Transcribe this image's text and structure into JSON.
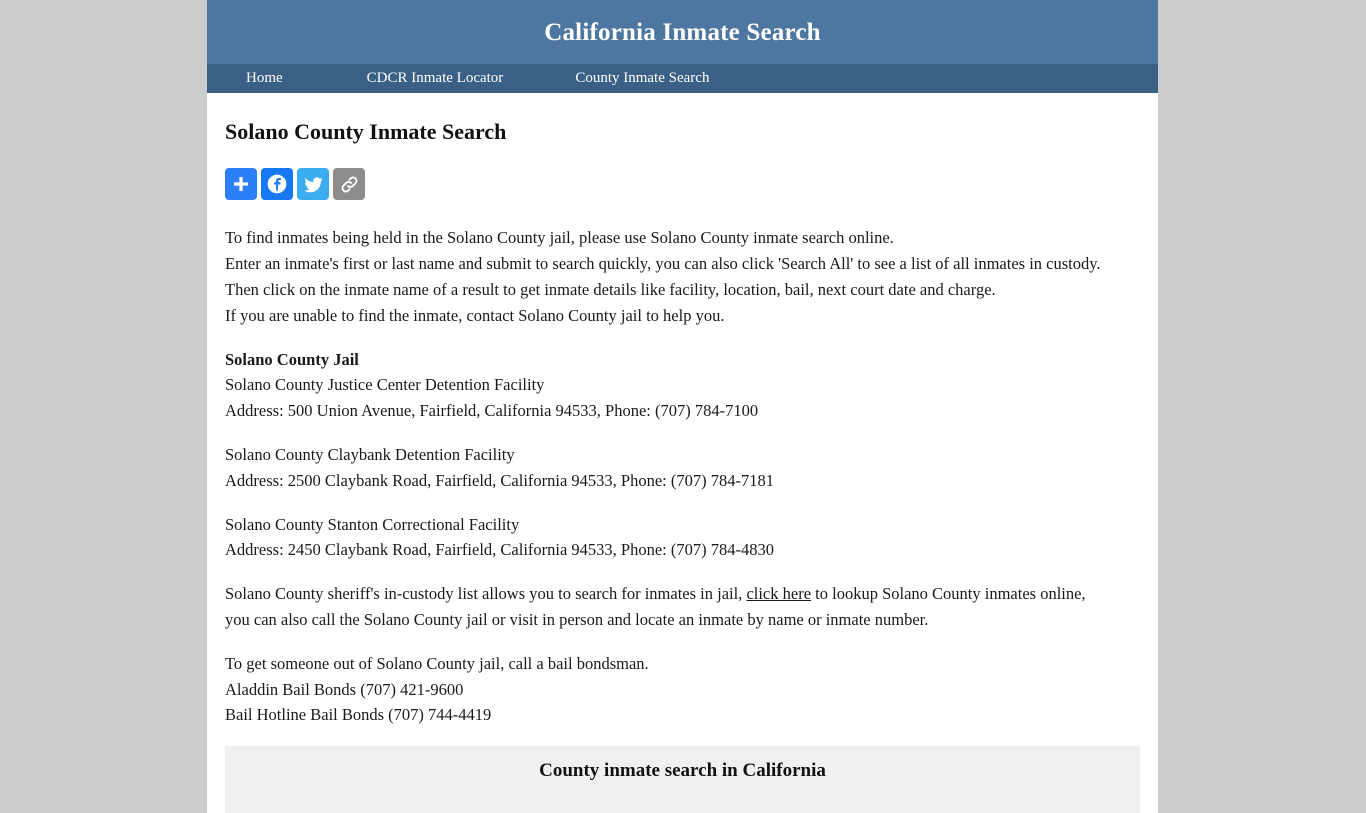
{
  "site": {
    "title": "California Inmate Search",
    "header_bg": "#4d76a0",
    "nav_bg": "#3a6086",
    "page_bg": "#cccccc"
  },
  "nav": {
    "items": [
      {
        "label": "Home"
      },
      {
        "label": "CDCR Inmate Locator"
      },
      {
        "label": "County Inmate Search"
      }
    ]
  },
  "page": {
    "heading": "Solano County Inmate Search"
  },
  "share": {
    "buttons": [
      {
        "name": "addthis",
        "label": "Share",
        "icon": "plus-icon",
        "color": "#2d7ff9"
      },
      {
        "name": "facebook",
        "label": "Facebook",
        "icon": "facebook-icon",
        "color": "#1877f2"
      },
      {
        "name": "twitter",
        "label": "Twitter",
        "icon": "twitter-icon",
        "color": "#3badee"
      },
      {
        "name": "copylink",
        "label": "Copy Link",
        "icon": "link-icon",
        "color": "#8c8c8c"
      }
    ]
  },
  "intro": {
    "line1": "To find inmates being held in the Solano County jail, please use Solano County inmate search online.",
    "line2": "Enter an inmate's first or last name and submit to search quickly, you can also click 'Search All' to see a list of all inmates in custody.",
    "line3": "Then click on the inmate name of a result to get inmate details like facility, location, bail, next court date and charge.",
    "line4": "If you are unable to find the inmate, contact Solano County jail to help you."
  },
  "jail": {
    "heading": "Solano County Jail",
    "facilities": [
      {
        "name": "Solano County Justice Center Detention Facility",
        "address": "Address: 500 Union Avenue, Fairfield, California 94533, Phone: (707) 784-7100"
      },
      {
        "name": "Solano County Claybank Detention Facility",
        "address": "Address: 2500 Claybank Road, Fairfield, California 94533, Phone: (707) 784-7181"
      },
      {
        "name": "Solano County Stanton Correctional Facility",
        "address": "Address: 2450 Claybank Road, Fairfield, California 94533, Phone: (707) 784-4830"
      }
    ]
  },
  "custody": {
    "before_link": "Solano County sheriff's in-custody list allows you to search for inmates in jail, ",
    "link_text": "click here",
    "after_link": " to lookup Solano County inmates online, you can also call the Solano County jail or visit in person and locate an inmate by name or inmate number."
  },
  "bail": {
    "line1": "To get someone out of Solano County jail, call a bail bondsman.",
    "line2": "Aladdin Bail Bonds (707) 421-9600",
    "line3": "Bail Hotline Bail Bonds (707) 744-4419"
  },
  "bottom_panel": {
    "heading": "County inmate search in California"
  }
}
